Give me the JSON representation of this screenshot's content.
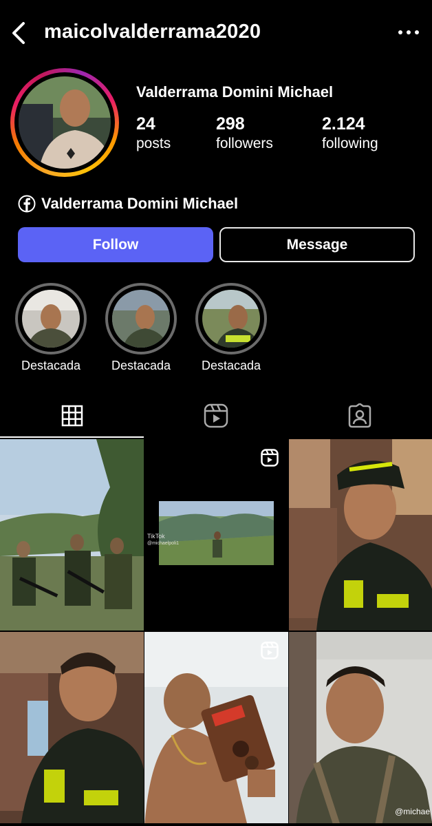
{
  "header": {
    "username": "maicolvalderrama2020",
    "back_icon": "chevron-left-icon",
    "more_icon": "more-horizontal-icon"
  },
  "profile": {
    "display_name": "Valderrama Domini Michael",
    "stats": [
      {
        "number": "24",
        "label": "posts"
      },
      {
        "number": "298",
        "label": "followers"
      },
      {
        "number": "2.124",
        "label": "following"
      }
    ],
    "linked_account": "Valderrama Domini Michael",
    "linked_icon": "facebook-icon"
  },
  "actions": {
    "follow_label": "Follow",
    "message_label": "Message"
  },
  "highlights": [
    {
      "label": "Destacada"
    },
    {
      "label": "Destacada"
    },
    {
      "label": "Destacada"
    }
  ],
  "tabs": [
    {
      "icon": "grid-icon",
      "active": true
    },
    {
      "icon": "reels-icon",
      "active": false
    },
    {
      "icon": "tagged-icon",
      "active": false
    }
  ],
  "posts": {
    "tiktok_label": "TikTok",
    "tiktok_handle": "@michaelpoli1",
    "tiktok_handle_2": "@michae"
  },
  "colors": {
    "follow_blue": "#5b63f5",
    "background": "#000000"
  }
}
